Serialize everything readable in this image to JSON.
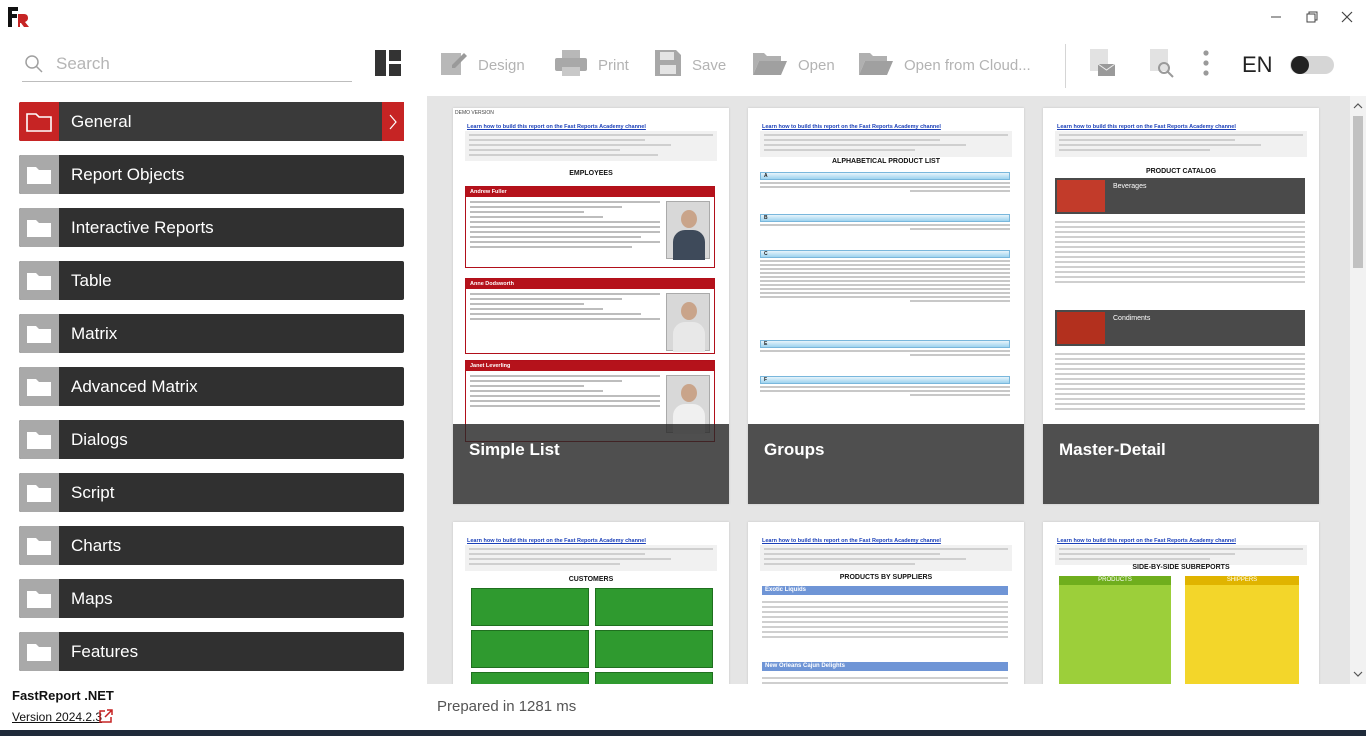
{
  "window": {
    "logo_letters": "FR",
    "controls": [
      "minimize",
      "restore",
      "close"
    ]
  },
  "toolbar": {
    "search_placeholder": "Search",
    "design_label": "Design",
    "print_label": "Print",
    "save_label": "Save",
    "open_label": "Open",
    "open_cloud_label": "Open from Cloud...",
    "language": "EN",
    "theme_toggle_on": false
  },
  "sidebar": {
    "items": [
      {
        "label": "General",
        "active": true
      },
      {
        "label": "Report Objects"
      },
      {
        "label": "Interactive Reports"
      },
      {
        "label": "Table"
      },
      {
        "label": "Matrix"
      },
      {
        "label": "Advanced Matrix"
      },
      {
        "label": "Dialogs"
      },
      {
        "label": "Script"
      },
      {
        "label": "Charts"
      },
      {
        "label": "Maps"
      },
      {
        "label": "Features"
      }
    ]
  },
  "gallery": {
    "demo_version": "DEMO VERSION",
    "link_text": "Learn how to build this report on the Fast Reports Academy channel",
    "cards": [
      {
        "name": "Simple List",
        "report_title": "EMPLOYEES",
        "employees": [
          "Andrew Fuller",
          "Anne Dodsworth",
          "Janet Leverling"
        ]
      },
      {
        "name": "Groups",
        "report_title": "ALPHABETICAL PRODUCT LIST",
        "groups": [
          "A",
          "B",
          "C",
          "E",
          "F"
        ]
      },
      {
        "name": "Master-Detail",
        "report_title": "PRODUCT CATALOG",
        "categories": [
          "Beverages",
          "Condiments"
        ]
      },
      {
        "report_title": "CUSTOMERS"
      },
      {
        "report_title": "PRODUCTS BY SUPPLIERS",
        "suppliers": [
          "Exotic Liquids",
          "New Orleans Cajun Delights"
        ]
      },
      {
        "report_title": "SIDE-BY-SIDE SUBREPORTS",
        "columns": [
          "PRODUCTS",
          "SHIPPERS"
        ]
      }
    ]
  },
  "footer": {
    "product": "FastReport .NET",
    "version": "Version 2024.2.3",
    "status": "Prepared in 1281 ms"
  }
}
